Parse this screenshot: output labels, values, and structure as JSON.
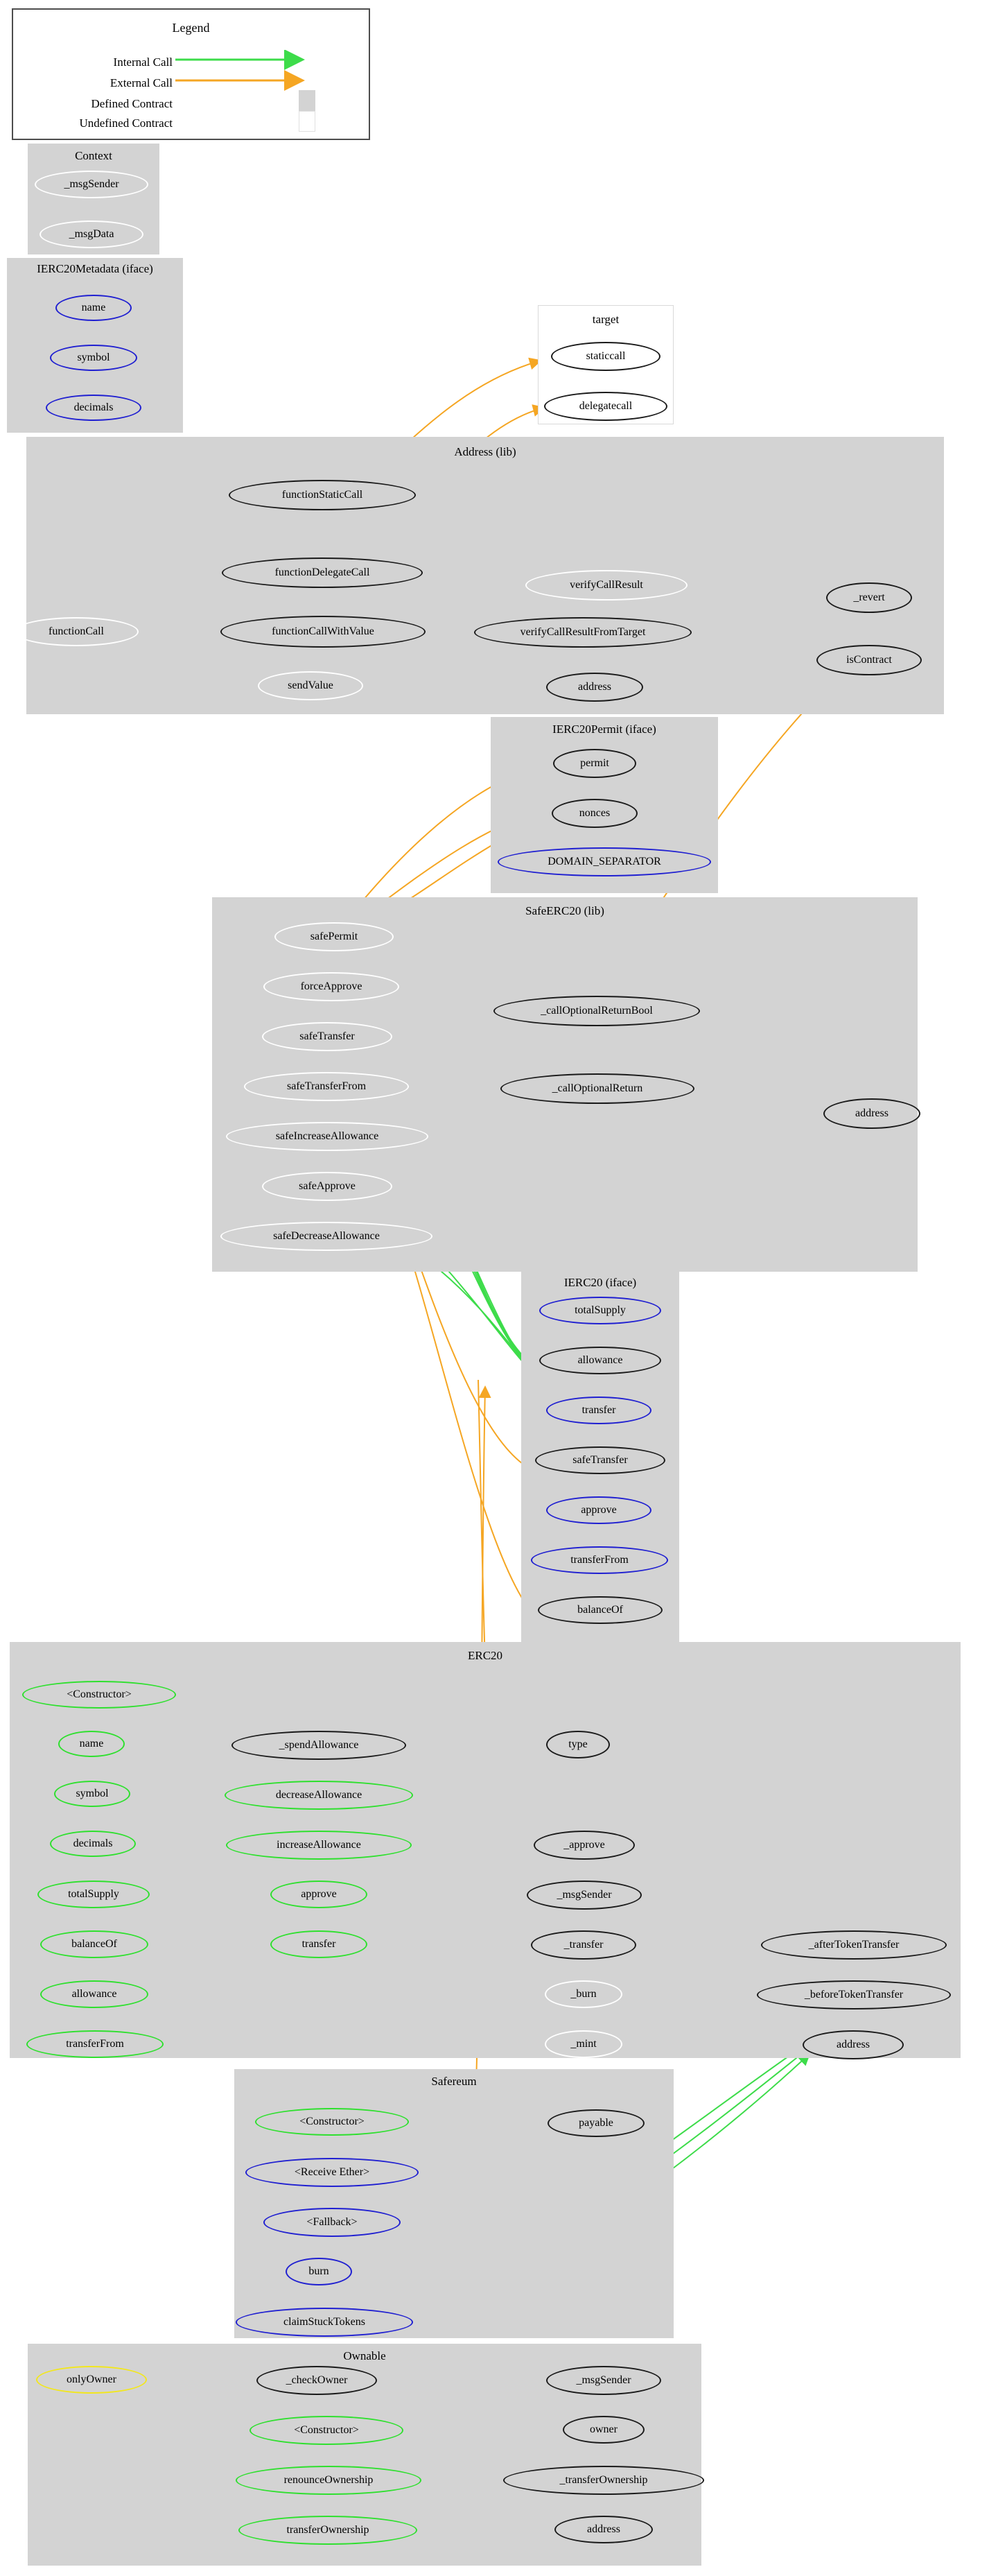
{
  "legend": {
    "title": "Legend",
    "rows": [
      {
        "label": "Internal Call",
        "kind": "arrow",
        "color": "#3ddc4a"
      },
      {
        "label": "External Call",
        "kind": "arrow",
        "color": "#f5a623"
      },
      {
        "label": "Defined Contract",
        "kind": "swatch",
        "color": "#d3d3d3"
      },
      {
        "label": "Undefined Contract",
        "kind": "swatch",
        "color": "#ffffff"
      }
    ]
  },
  "colors": {
    "internal_call": "#3ddc4a",
    "external_call": "#f5a623",
    "defined_contract_fill": "#d3d3d3",
    "undefined_contract_fill": "#ffffff",
    "node_internal_border": "#1a1a1a",
    "node_public_border": "#2ee02e",
    "node_interface_border": "#1f1fd1",
    "node_unused_border": "#ffffff",
    "node_modifier_border": "#f2e71d"
  },
  "clusters": [
    {
      "id": "context",
      "title": "Context",
      "fill": "defined",
      "nodes": [
        {
          "label": "_msgSender",
          "border": "white"
        },
        {
          "label": "_msgData",
          "border": "white"
        }
      ]
    },
    {
      "id": "ierc20metadata",
      "title": "IERC20Metadata  (iface)",
      "fill": "defined",
      "nodes": [
        {
          "label": "name",
          "border": "blue"
        },
        {
          "label": "symbol",
          "border": "blue"
        },
        {
          "label": "decimals",
          "border": "blue"
        }
      ]
    },
    {
      "id": "target",
      "title": "target",
      "fill": "undefined",
      "nodes": [
        {
          "label": "staticcall",
          "border": "black"
        },
        {
          "label": "delegatecall",
          "border": "black"
        }
      ]
    },
    {
      "id": "address_lib",
      "title": "Address  (lib)",
      "fill": "defined",
      "nodes": [
        {
          "label": "functionStaticCall",
          "border": "black"
        },
        {
          "label": "functionDelegateCall",
          "border": "black"
        },
        {
          "label": "functionCall",
          "border": "white"
        },
        {
          "label": "functionCallWithValue",
          "border": "black"
        },
        {
          "label": "sendValue",
          "border": "white"
        },
        {
          "label": "verifyCallResult",
          "border": "white"
        },
        {
          "label": "verifyCallResultFromTarget",
          "border": "black"
        },
        {
          "label": "address",
          "border": "black"
        },
        {
          "label": "_revert",
          "border": "black"
        },
        {
          "label": "isContract",
          "border": "black"
        }
      ]
    },
    {
      "id": "ierc20permit",
      "title": "IERC20Permit  (iface)",
      "fill": "defined",
      "nodes": [
        {
          "label": "permit",
          "border": "black"
        },
        {
          "label": "nonces",
          "border": "black"
        },
        {
          "label": "DOMAIN_SEPARATOR",
          "border": "blue"
        }
      ]
    },
    {
      "id": "safeerc20",
      "title": "SafeERC20  (lib)",
      "fill": "defined",
      "nodes": [
        {
          "label": "safePermit",
          "border": "white"
        },
        {
          "label": "forceApprove",
          "border": "white"
        },
        {
          "label": "safeTransfer",
          "border": "white"
        },
        {
          "label": "safeTransferFrom",
          "border": "white"
        },
        {
          "label": "safeIncreaseAllowance",
          "border": "white"
        },
        {
          "label": "safeApprove",
          "border": "white"
        },
        {
          "label": "safeDecreaseAllowance",
          "border": "white"
        },
        {
          "label": "_callOptionalReturnBool",
          "border": "black"
        },
        {
          "label": "_callOptionalReturn",
          "border": "black"
        },
        {
          "label": "address",
          "border": "black"
        }
      ]
    },
    {
      "id": "ierc20",
      "title": "IERC20  (iface)",
      "fill": "defined",
      "nodes": [
        {
          "label": "totalSupply",
          "border": "blue"
        },
        {
          "label": "allowance",
          "border": "black"
        },
        {
          "label": "transfer",
          "border": "blue"
        },
        {
          "label": "safeTransfer",
          "border": "black"
        },
        {
          "label": "approve",
          "border": "blue"
        },
        {
          "label": "transferFrom",
          "border": "blue"
        },
        {
          "label": "balanceOf",
          "border": "black"
        }
      ]
    },
    {
      "id": "erc20",
      "title": "ERC20",
      "fill": "defined",
      "nodes": [
        {
          "label": "<Constructor>",
          "border": "green"
        },
        {
          "label": "name",
          "border": "green"
        },
        {
          "label": "symbol",
          "border": "green"
        },
        {
          "label": "decimals",
          "border": "green"
        },
        {
          "label": "totalSupply",
          "border": "green"
        },
        {
          "label": "balanceOf",
          "border": "green"
        },
        {
          "label": "allowance",
          "border": "green"
        },
        {
          "label": "transferFrom",
          "border": "green"
        },
        {
          "label": "_spendAllowance",
          "border": "black"
        },
        {
          "label": "decreaseAllowance",
          "border": "green"
        },
        {
          "label": "increaseAllowance",
          "border": "green"
        },
        {
          "label": "approve",
          "border": "green"
        },
        {
          "label": "transfer",
          "border": "green"
        },
        {
          "label": "type",
          "border": "black"
        },
        {
          "label": "_approve",
          "border": "black"
        },
        {
          "label": "_msgSender",
          "border": "black"
        },
        {
          "label": "_transfer",
          "border": "black"
        },
        {
          "label": "_burn",
          "border": "white"
        },
        {
          "label": "_mint",
          "border": "white"
        },
        {
          "label": "_afterTokenTransfer",
          "border": "black"
        },
        {
          "label": "_beforeTokenTransfer",
          "border": "black"
        },
        {
          "label": "address",
          "border": "black"
        }
      ]
    },
    {
      "id": "safereum",
      "title": "Safereum",
      "fill": "defined",
      "nodes": [
        {
          "label": "<Constructor>",
          "border": "green"
        },
        {
          "label": "<Receive Ether>",
          "border": "blue"
        },
        {
          "label": "<Fallback>",
          "border": "blue"
        },
        {
          "label": "burn",
          "border": "blue"
        },
        {
          "label": "claimStuckTokens",
          "border": "blue"
        },
        {
          "label": "payable",
          "border": "black"
        }
      ]
    },
    {
      "id": "ownable",
      "title": "Ownable",
      "fill": "defined",
      "nodes": [
        {
          "label": "onlyOwner",
          "border": "yellow"
        },
        {
          "label": "_checkOwner",
          "border": "black"
        },
        {
          "label": "<Constructor>",
          "border": "green"
        },
        {
          "label": "renounceOwnership",
          "border": "green"
        },
        {
          "label": "transferOwnership",
          "border": "green"
        },
        {
          "label": "_msgSender",
          "border": "black"
        },
        {
          "label": "owner",
          "border": "black"
        },
        {
          "label": "_transferOwnership",
          "border": "black"
        },
        {
          "label": "address",
          "border": "black"
        }
      ]
    }
  ]
}
